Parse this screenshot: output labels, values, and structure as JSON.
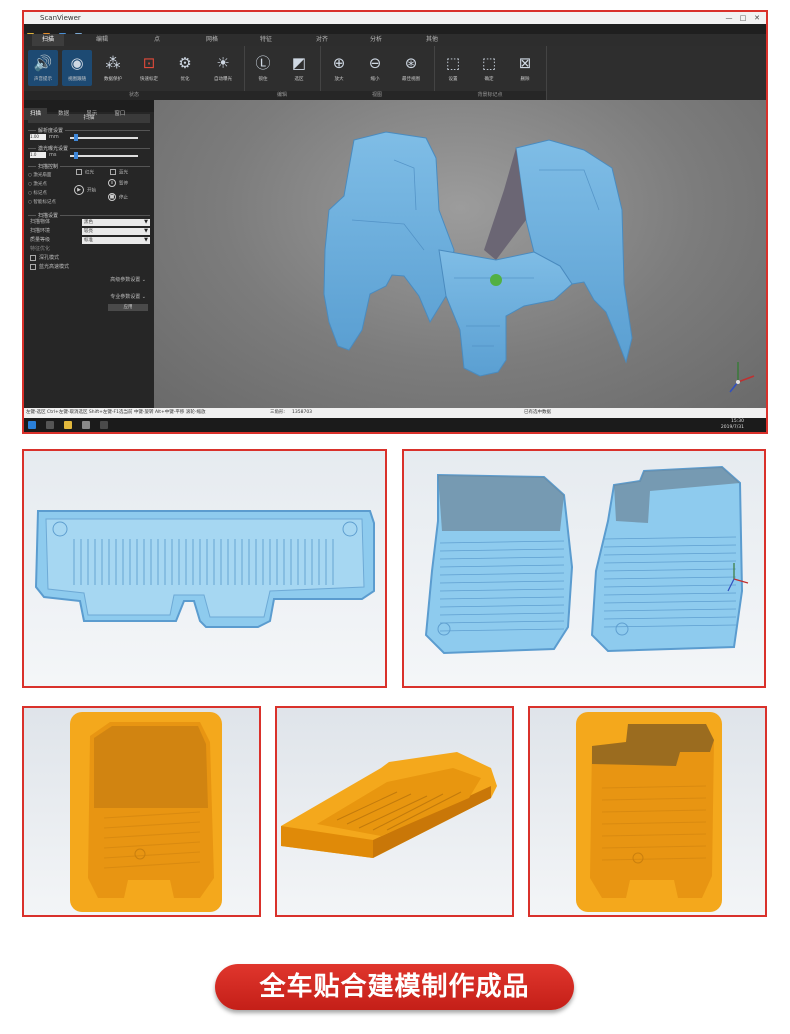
{
  "app": {
    "title": "ScanViewer",
    "window_controls": [
      "—",
      "□",
      "✕"
    ],
    "menu": [
      "扫描",
      "编辑",
      "点",
      "网格",
      "特征",
      "对齐",
      "分析",
      "其他"
    ],
    "active_menu_index": 0,
    "ribbon_groups": [
      {
        "label": "状态",
        "buttons": [
          {
            "label": "声音提示",
            "icon": "speaker-icon",
            "selected": true
          },
          {
            "label": "视图跟随",
            "icon": "eye-icon",
            "selected": true
          },
          {
            "label": "数据保护",
            "icon": "data-icon",
            "selected": false
          },
          {
            "label": "快速标定",
            "icon": "calibration-icon",
            "selected": false
          },
          {
            "label": "优化",
            "icon": "gear-icon",
            "selected": false
          },
          {
            "label": "自动曝光",
            "icon": "exposure-icon",
            "selected": false
          }
        ]
      },
      {
        "label": "编辑",
        "buttons": [
          {
            "label": "锁住",
            "icon": "lock-view-icon",
            "selected": false
          },
          {
            "label": "选区",
            "icon": "selection-icon",
            "selected": false
          }
        ]
      },
      {
        "label": "视图",
        "buttons": [
          {
            "label": "放大",
            "icon": "zoom-in-icon",
            "selected": false
          },
          {
            "label": "缩小",
            "icon": "zoom-out-icon",
            "selected": false
          },
          {
            "label": "最佳视图",
            "icon": "zoom-fit-icon",
            "selected": false
          }
        ]
      },
      {
        "label": "背景标记点",
        "buttons": [
          {
            "label": "设置",
            "icon": "set-marker-icon",
            "selected": false
          },
          {
            "label": "确定",
            "icon": "confirm-marker-icon",
            "selected": false
          },
          {
            "label": "删除",
            "icon": "delete-marker-icon",
            "selected": false
          }
        ]
      }
    ],
    "panel": {
      "tabs": [
        "扫描",
        "数据",
        "显示",
        "窗口"
      ],
      "active_tab_index": 0,
      "header": "扫描",
      "resolution_section": "解析度设置",
      "resolution_value": "1.00",
      "resolution_unit": "mm",
      "exposure_section": "激光曝光设置",
      "exposure_value": "1.0",
      "exposure_unit": "ms",
      "scan_control_section": "扫描控制",
      "scan_modes": [
        "激光扇面",
        "激光点",
        "标记点",
        "智能标记点"
      ],
      "light_options": [
        "红光",
        "蓝光"
      ],
      "start_label": "开始",
      "pause_label": "暂停",
      "stop_label": "停止",
      "scan_settings_section": "扫描设置",
      "settings": [
        {
          "label": "扫描物体",
          "value": "黑色"
        },
        {
          "label": "扫描环境",
          "value": "较亮"
        },
        {
          "label": "质量等级",
          "value": "标准"
        }
      ],
      "checkbox_options": [
        "特征优化",
        "深孔模式",
        "蓝光高速模式"
      ],
      "advanced_params": "高级参数设置",
      "expert_params": "专业参数设置",
      "apply_label": "应用"
    },
    "status": {
      "hint": "左键-选区 Ctrl+左键-取消选区 Shift+左键-F1选当前 中键-旋转 Alt+中键-平移 滚轮-缩放",
      "triangles_label": "三角形:",
      "triangles_value": "1358703",
      "selection": "已有选中数据"
    },
    "clock": {
      "time": "15:30",
      "date": "2019/7/31"
    }
  },
  "caption": "全车贴合建模制作成品",
  "colors": {
    "frame_border": "#d9312b",
    "scan_blue": "#6fb0dd",
    "mold_orange": "#f4a81c",
    "caption_red": "#d62c24"
  }
}
